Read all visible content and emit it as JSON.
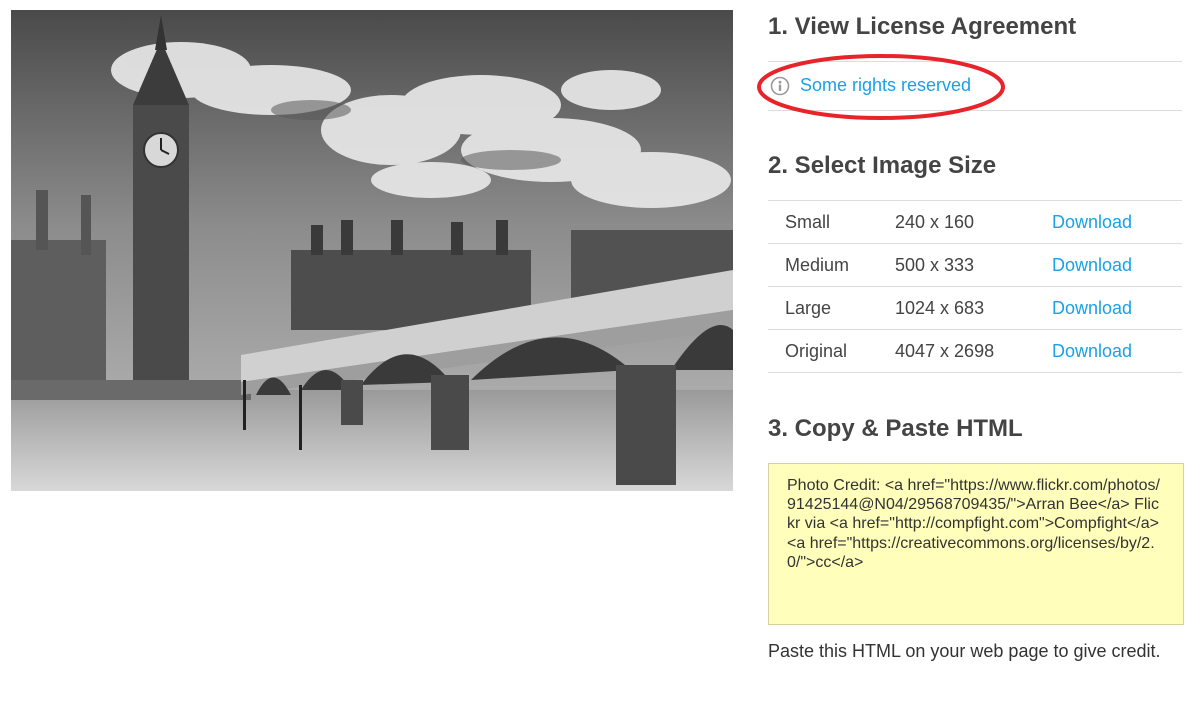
{
  "photo": {
    "description_icon": "photo-westminster-bridge-big-ben"
  },
  "section1": {
    "title": "1. View License Agreement",
    "license_link": "Some rights reserved",
    "icon": "info-circle-icon"
  },
  "section2": {
    "title": "2. Select Image Size",
    "rows": [
      {
        "name": "Small",
        "dims": "240 x 160",
        "action": "Download"
      },
      {
        "name": "Medium",
        "dims": "500 x 333",
        "action": "Download"
      },
      {
        "name": "Large",
        "dims": "1024 x 683",
        "action": "Download"
      },
      {
        "name": "Original",
        "dims": "4047 x 2698",
        "action": "Download"
      }
    ]
  },
  "section3": {
    "title": "3. Copy & Paste HTML",
    "code": "Photo Credit: <a href=\"https://www.flickr.com/photos/91425144@N04/29568709435/\">Arran Bee</a> Flickr via <a href=\"http://compfight.com\">Compfight</a> <a href=\"https://creativecommons.org/licenses/by/2.0/\">cc</a>",
    "note": "Paste this HTML on your web page to give credit."
  },
  "colors": {
    "link": "#1aa1e6",
    "highlight_ellipse": "#e8232a",
    "code_background": "#ffffbb"
  }
}
